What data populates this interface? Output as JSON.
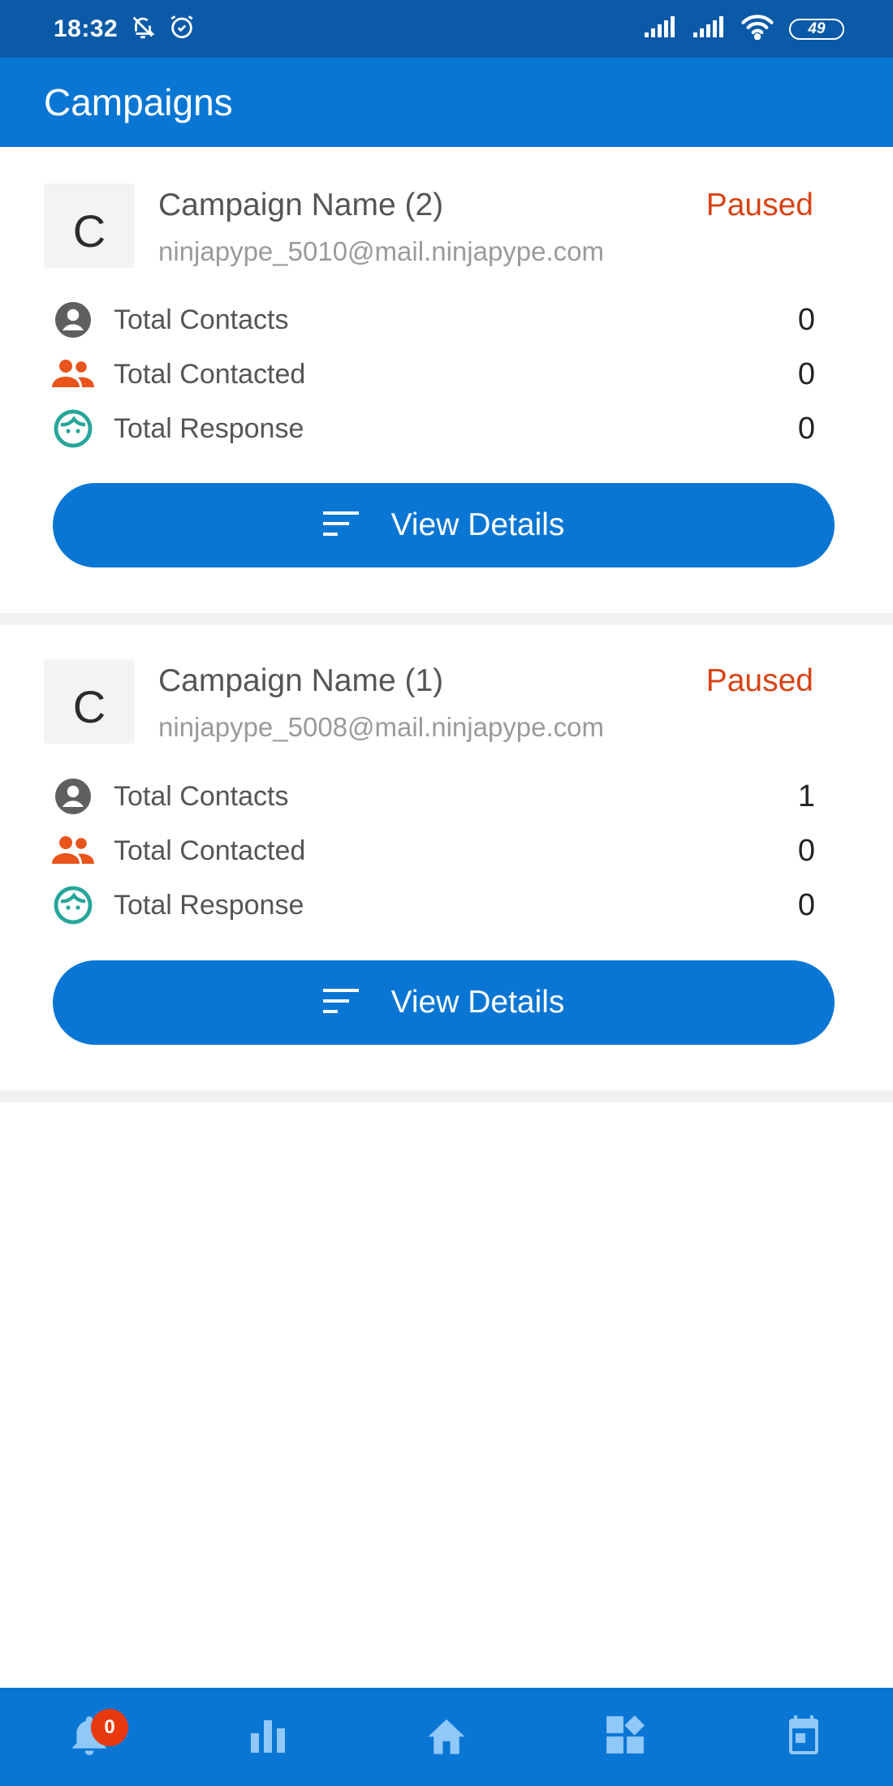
{
  "status_bar": {
    "time": "18:32",
    "battery": "49",
    "icons": [
      "bell-off-icon",
      "alarm-icon",
      "signal-icon",
      "signal-icon",
      "wifi-icon",
      "battery-icon"
    ]
  },
  "app_bar": {
    "title": "Campaigns"
  },
  "colors": {
    "primary": "#0a76d4",
    "status_bar": "#0a5aa8",
    "paused": "#d84315",
    "contacted_icon": "#e8541c",
    "response_icon": "#26a69a",
    "contacts_icon": "#5f5f5f",
    "badge": "#e8390e"
  },
  "campaigns": [
    {
      "avatar_letter": "C",
      "name": "Campaign Name (2)",
      "email": "ninjapype_5010@mail.ninjapype.com",
      "status": "Paused",
      "stats": [
        {
          "label": "Total Contacts",
          "value": "0",
          "icon": "person-circle-icon"
        },
        {
          "label": "Total Contacted",
          "value": "0",
          "icon": "people-icon"
        },
        {
          "label": "Total Response",
          "value": "0",
          "icon": "face-icon"
        }
      ],
      "button_label": "View Details"
    },
    {
      "avatar_letter": "C",
      "name": "Campaign Name (1)",
      "email": "ninjapype_5008@mail.ninjapype.com",
      "status": "Paused",
      "stats": [
        {
          "label": "Total Contacts",
          "value": "1",
          "icon": "person-circle-icon"
        },
        {
          "label": "Total Contacted",
          "value": "0",
          "icon": "people-icon"
        },
        {
          "label": "Total Response",
          "value": "0",
          "icon": "face-icon"
        }
      ],
      "button_label": "View Details"
    }
  ],
  "bottom_nav": {
    "notification_count": "0",
    "items": [
      "notifications-icon",
      "bar-chart-icon",
      "home-icon",
      "widgets-icon",
      "calendar-icon"
    ]
  }
}
